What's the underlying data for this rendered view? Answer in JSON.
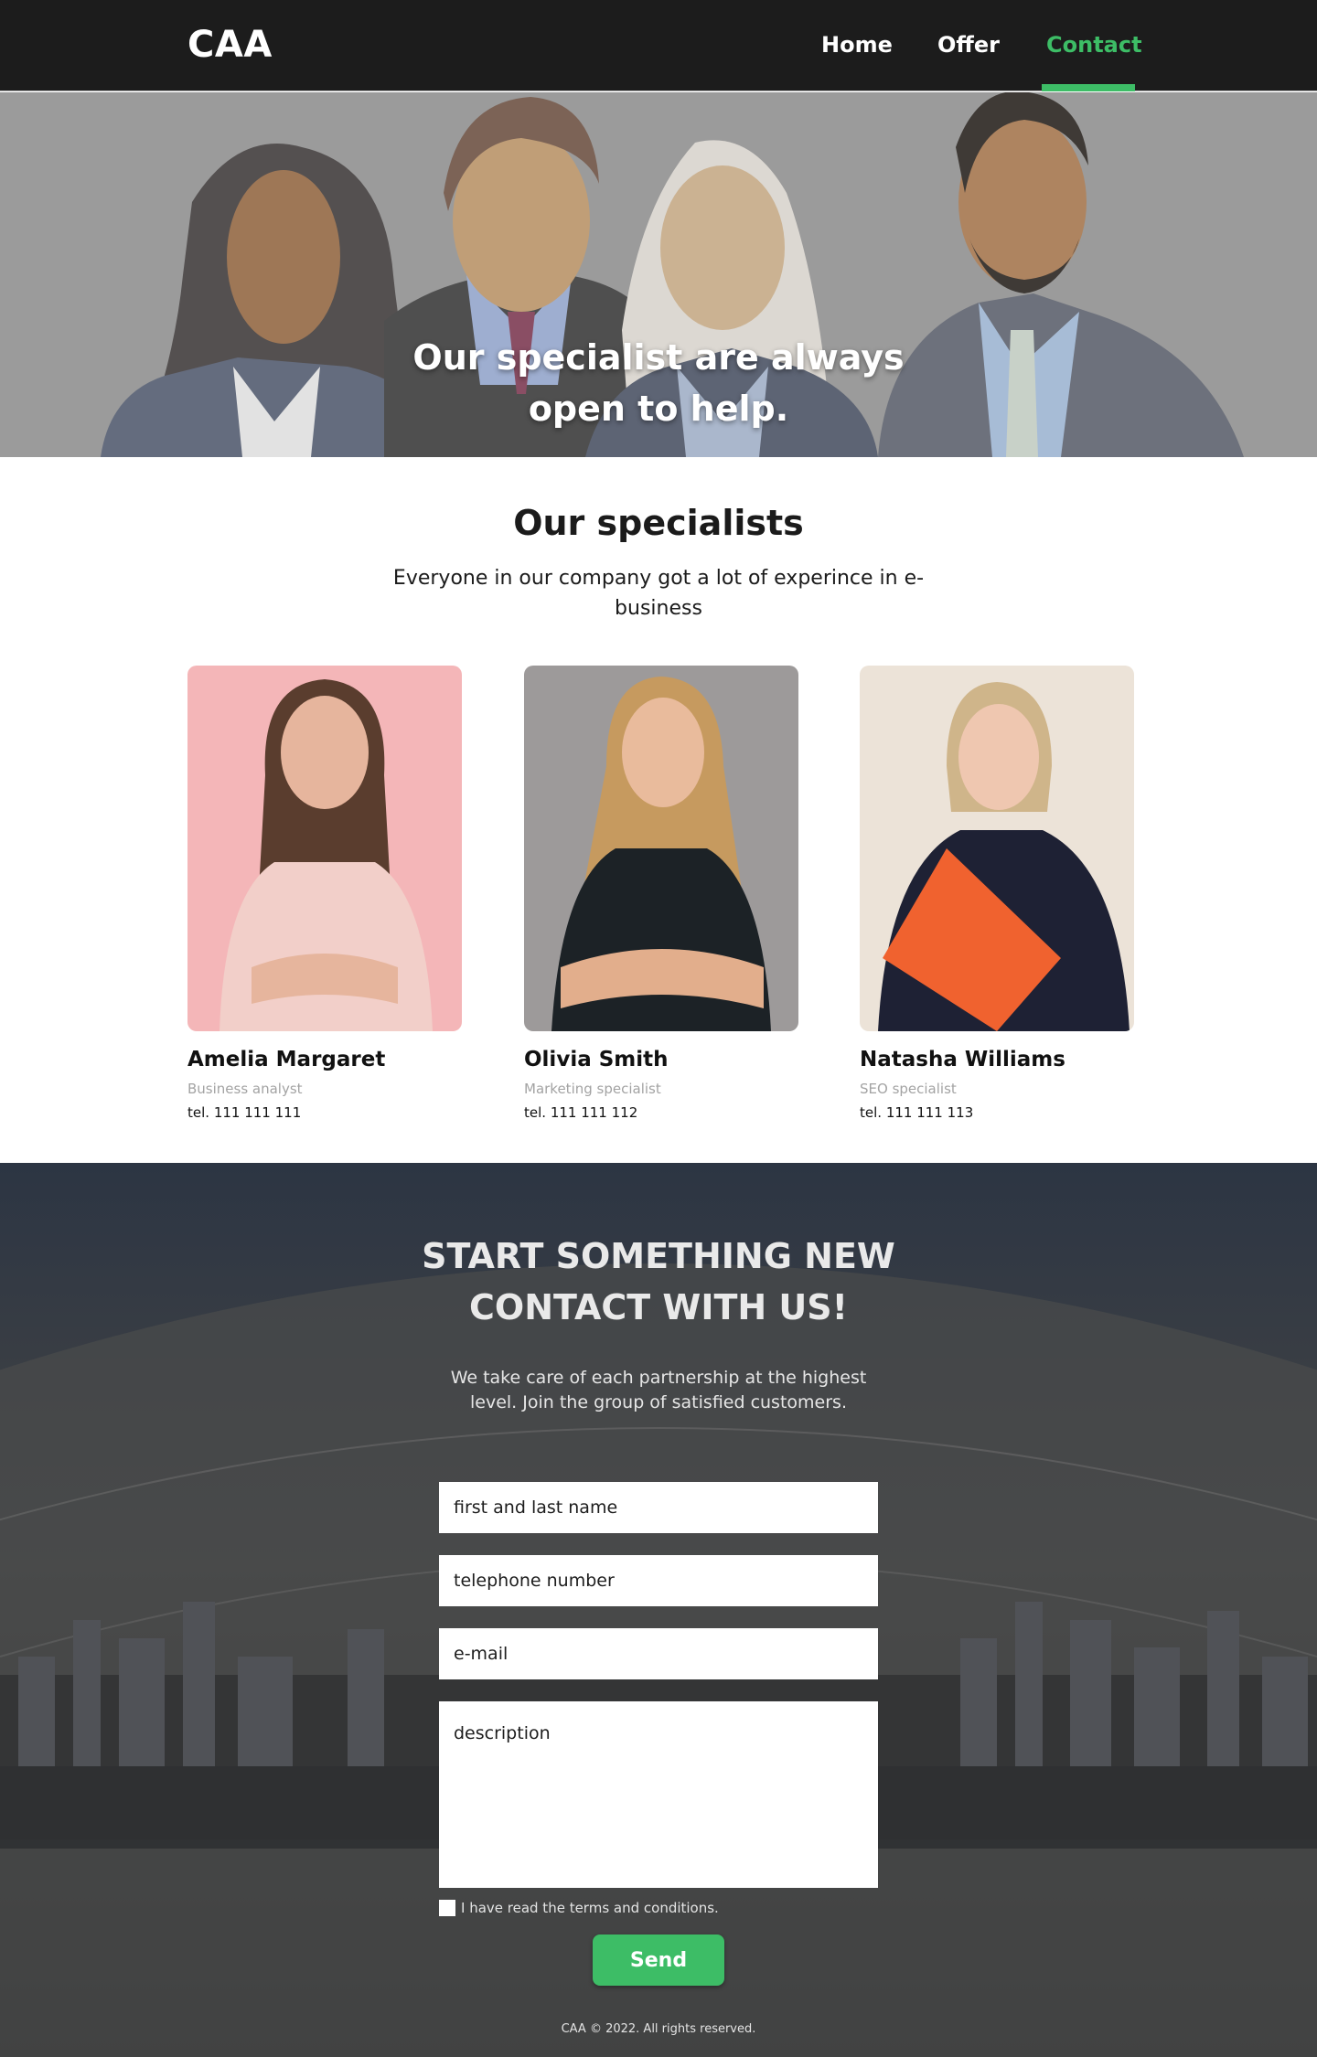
{
  "header": {
    "logo": "CAA",
    "nav": [
      {
        "label": "Home",
        "active": false
      },
      {
        "label": "Offer",
        "active": false
      },
      {
        "label": "Contact",
        "active": true
      }
    ],
    "accent_color": "#3dbd66"
  },
  "hero": {
    "title_line1": "Our specialist are always",
    "title_line2": "open to help."
  },
  "specialists": {
    "title": "Our specialists",
    "subtitle": "Everyone in our company got a lot of experince in e-business",
    "people": [
      {
        "name": "Amelia Margaret",
        "role": "Business analyst",
        "tel": "tel. 111 111 111",
        "photo_bg": "#f4b6b8"
      },
      {
        "name": "Olivia Smith",
        "role": "Marketing specialist",
        "tel": "tel. 111 111 112",
        "photo_bg": "#9d9a9a"
      },
      {
        "name": "Natasha Williams",
        "role": "SEO specialist",
        "tel": "tel. 111 111 113",
        "photo_bg": "#ece3d8"
      }
    ]
  },
  "contact": {
    "title_line1": "START SOMETHING NEW",
    "title_line2": "CONTACT WITH US!",
    "subtitle": "We take care of each partnership at the highest level. Join the group of satisfied customers.",
    "fields": {
      "name_placeholder": "first and last name",
      "phone_placeholder": "telephone number",
      "email_placeholder": "e-mail",
      "description_placeholder": "description"
    },
    "terms_label": "I have read the terms and conditions.",
    "send_label": "Send"
  },
  "footer": {
    "text": "CAA © 2022. All rights reserved."
  }
}
